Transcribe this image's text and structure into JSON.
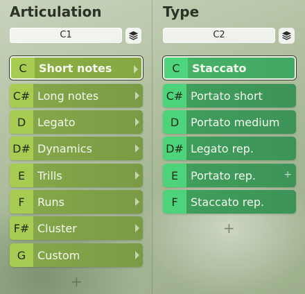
{
  "articulation": {
    "title": "Articulation",
    "selector_value": "C1",
    "items": [
      {
        "key": "C",
        "label": "Short notes"
      },
      {
        "key": "C#",
        "label": "Long notes"
      },
      {
        "key": "D",
        "label": "Legato"
      },
      {
        "key": "D#",
        "label": "Dynamics"
      },
      {
        "key": "E",
        "label": "Trills"
      },
      {
        "key": "F",
        "label": "Runs"
      },
      {
        "key": "F#",
        "label": "Cluster"
      },
      {
        "key": "G",
        "label": "Custom"
      }
    ],
    "add_label": "+"
  },
  "type": {
    "title": "Type",
    "selector_value": "C2",
    "items": [
      {
        "key": "C",
        "label": "Staccato"
      },
      {
        "key": "C#",
        "label": "Portato short"
      },
      {
        "key": "D",
        "label": "Portato medium"
      },
      {
        "key": "D#",
        "label": "Legato rep."
      },
      {
        "key": "E",
        "label": "Portato rep.",
        "plus": "+"
      },
      {
        "key": "F",
        "label": "Staccato rep."
      }
    ],
    "add_label": "+"
  }
}
